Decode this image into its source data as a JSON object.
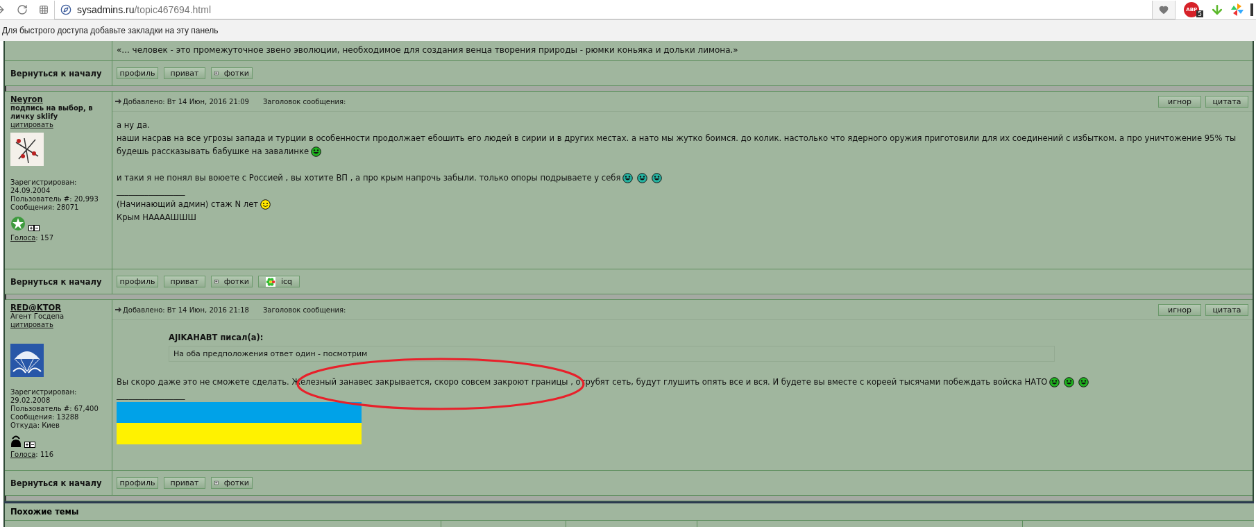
{
  "browser": {
    "url_domain": "sysadmins.ru",
    "url_path": "/topic467694.html",
    "bookmarks_hint": "Для быстрого доступа добавьте закладки на эту панель",
    "extension_label": "ABP",
    "extension_count": "5"
  },
  "previous_post": {
    "signature_line": "«... человек - это промежуточное звено эволюции, необходимое для создания венца творения природы - рюмки коньяка и дольки лимона.»",
    "back_link": "Вернуться к началу",
    "buttons": [
      {
        "kind": "plain",
        "label": "профиль"
      },
      {
        "kind": "plain",
        "label": "приват"
      },
      {
        "kind": "photos",
        "label": "фотки"
      }
    ]
  },
  "posts": [
    {
      "author": "Neyron",
      "rank": "подпись на выбор, в личку sklify",
      "rank_bold": true,
      "quote_link": "цитировать",
      "avatar": {
        "kind": "sketch"
      },
      "details": [
        "Зарегистрирован:",
        "24.09.2004",
        "Пользователь #: 20,993",
        "Сообщения: 28071"
      ],
      "badge": {
        "kind": "star"
      },
      "votes_label": "Голоса",
      "votes_separator": ":",
      "votes": "157",
      "meta_added": "Добавлено: Вт 14 Июн, 2016 21:09",
      "meta_subject": "Заголовок сообщения:",
      "header_buttons": [
        "игнор",
        "цитата"
      ],
      "body": [
        {
          "kind": "text",
          "text": "а ну да."
        },
        {
          "kind": "text",
          "text": "наши насрав на все угрозы запада и турции в особенности продолжает ебошить его людей в сирии и в других местах. а нато мы жутко боимся. до колик. настолько что ядерного оружия приготовили для их соединений с избытком. а про уничтожение 95% ты"
        },
        {
          "kind": "text",
          "text": "будешь рассказывать бабушке на завалинке",
          "emoticons": [
            {
              "kind": "angry"
            }
          ]
        },
        {
          "kind": "gap"
        },
        {
          "kind": "text",
          "text": "и таки я не понял вы воюете с Россией , вы хотите ВП , а про крым напрочь забыли. только опоры подрываете у себя",
          "emoticons": [
            {
              "kind": "grin"
            },
            {
              "kind": "grin"
            },
            {
              "kind": "grin"
            }
          ]
        },
        {
          "kind": "rule",
          "text": "_________________"
        },
        {
          "kind": "text",
          "text": "(Начинающий админ) стаж N лет",
          "emoticons": [
            {
              "kind": "smile"
            }
          ]
        },
        {
          "kind": "text",
          "text": "Крым НААААШШШ"
        }
      ],
      "back_link": "Вернуться к началу",
      "buttons": [
        {
          "kind": "plain",
          "label": "профиль"
        },
        {
          "kind": "plain",
          "label": "приват"
        },
        {
          "kind": "photos",
          "label": "фотки"
        },
        {
          "kind": "icq",
          "label": "icq"
        }
      ]
    },
    {
      "author": "RED@KTOR",
      "rank": "Агент Госдепа",
      "rank_bold": false,
      "quote_link": "цитировать",
      "avatar": {
        "kind": "parachute"
      },
      "details": [
        "Зарегистрирован:",
        "29.02.2008",
        "Пользователь #: 67,400",
        "Сообщения: 13288",
        "Откуда: Киев"
      ],
      "badge": {
        "kind": "kettle"
      },
      "votes_label": "Голоса",
      "votes_separator": ":",
      "votes": "116",
      "meta_added": "Добавлено: Вт 14 Июн, 2016 21:18",
      "meta_subject": "Заголовок сообщения:",
      "header_buttons": [
        "игнор",
        "цитата"
      ],
      "body": [
        {
          "kind": "quote",
          "author": "AJIKAHABT писал(а):",
          "text": "На оба предположения ответ один - посмотрим"
        },
        {
          "kind": "text",
          "text": "Вы скоро даже это не сможете сделать. Железный занавес закрывается, скоро совсем закроют границы , отрубят сеть, будут глушить опять все и вся. И будете вы вместе с кореей тысячами побеждать войска НАТО",
          "emoticons": [
            {
              "kind": "angry"
            },
            {
              "kind": "angry"
            },
            {
              "kind": "angry"
            }
          ],
          "highlighted": true
        },
        {
          "kind": "rule",
          "text": "_________________"
        },
        {
          "kind": "flag"
        }
      ],
      "back_link": "Вернуться к началу",
      "buttons": [
        {
          "kind": "plain",
          "label": "профиль"
        },
        {
          "kind": "plain",
          "label": "приват"
        },
        {
          "kind": "photos",
          "label": "фотки"
        }
      ]
    }
  ],
  "similar_topics": {
    "title": "Похожие темы"
  }
}
